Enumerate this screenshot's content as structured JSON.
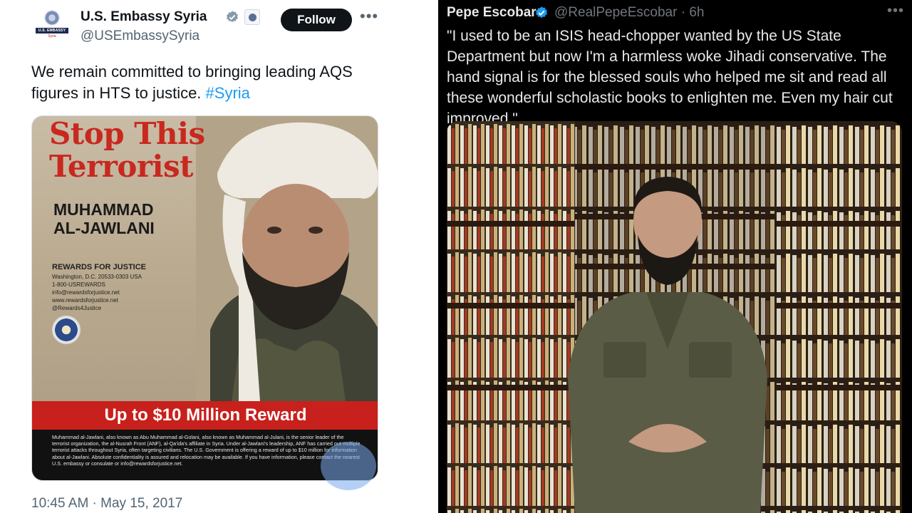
{
  "left_tweet": {
    "author_name": "U.S. Embassy Syria",
    "handle": "@USEmbassySyria",
    "avatar_text": "U.S. EMBASSY",
    "avatar_subtext": "Syria",
    "follow_label": "Follow",
    "more_label": "•••",
    "text": "We remain committed to bringing leading AQS figures in HTS to justice. ",
    "hashtag": "#Syria",
    "timestamp": "10:45 AM · May 15, 2017",
    "poster": {
      "title_line1": "Stop This",
      "title_line2": "Terrorist",
      "name_line1": "MUHAMMAD",
      "name_line2": "AL-JAWLANI",
      "org": "REWARDS FOR JUSTICE",
      "address": "Washington, D.C. 20533-0303 USA",
      "phone": "1-800-USREWARDS",
      "email": "info@rewardsforjustice.net",
      "website": "www.rewardsforjustice.net",
      "twitter": "@Rewards4Justice",
      "reward_text": "Up to $10 Million Reward",
      "fine_print": "Muhammad al-Jawlani, also known as Abu Muhammad al-Golani, also known as Muhammad al-Julani, is the senior leader of the terrorist organization, the al-Nusrah Front (ANF), al-Qa'ida's affiliate in Syria. Under al-Jawlani's leadership, ANF has carried out multiple terrorist attacks throughout Syria, often targeting civilians. The U.S. Government is offering a reward of up to $10 million for information about al-Jawlani. Absolute confidentiality is assured and relocation may be available. If you have information, please contact the nearest U.S. embassy or consulate or info@rewardsforjustice.net."
    }
  },
  "right_tweet": {
    "author_name": "Pepe Escobar",
    "handle_time": "@RealPepeEscobar · 6h",
    "more_label": "•••",
    "quote": "\"I used to be an ISIS head-chopper wanted by the US State Department but now I'm a harmless woke Jihadi  conservative. The hand signal is for the blessed souls who helped me sit and read all these wonderful scholastic books to enlighten me. Even my hair cut improved.\""
  },
  "colors": {
    "accent_blue": "#1d9bf0",
    "poster_red": "#c8281f",
    "dark_bg": "#000000"
  }
}
